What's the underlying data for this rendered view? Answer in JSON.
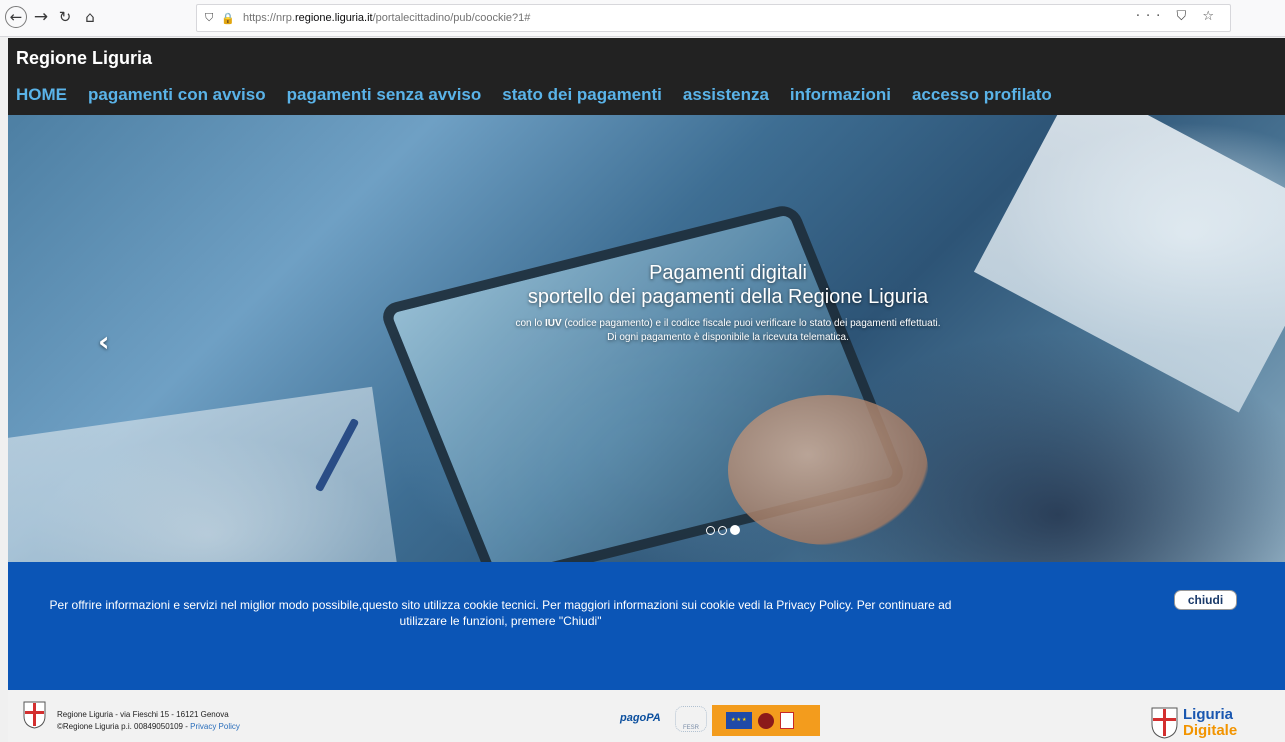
{
  "browser": {
    "url_prefix": "https://nrp.",
    "url_domain": "regione.liguria.it",
    "url_path": "/portalecittadino/pub/coockie?1#",
    "icons": [
      "back-arrow-icon",
      "forward-arrow-icon",
      "reload-icon",
      "home-icon",
      "shield-icon",
      "lock-icon",
      "more-icon",
      "pocket-icon",
      "bookmark-star-icon"
    ]
  },
  "site": {
    "brand": "Regione Liguria",
    "menu": [
      {
        "label": "HOME"
      },
      {
        "label": "pagamenti con avviso"
      },
      {
        "label": "pagamenti senza avviso"
      },
      {
        "label": "stato dei pagamenti"
      },
      {
        "label": "assistenza"
      },
      {
        "label": "informazioni"
      },
      {
        "label": "accesso profilato"
      }
    ],
    "colors": {
      "header_bg": "#222222",
      "menu_link": "#5ab3e8",
      "cookie_bg": "#0b55b6"
    }
  },
  "hero": {
    "title": "Pagamenti digitali",
    "subtitle": "sportello dei pagamenti della Regione Liguria",
    "text_pre": "con lo ",
    "text_bold": "IUV",
    "text_post": " (codice pagamento) e il codice fiscale puoi verificare lo stato dei pagamenti effettuati.",
    "text_line2": "Di ogni pagamento è disponibile la ricevuta telematica.",
    "slides": 3,
    "active_slide": 3
  },
  "cookie": {
    "message": "Per offrire informazioni e servizi nel miglior modo possibile,questo sito utilizza cookie tecnici. Per maggiori informazioni sui cookie vedi la Privacy Policy. Per continuare ad utilizzare le funzioni, premere \"Chiudi\"",
    "close_label": "chiudi"
  },
  "footer": {
    "address": "Regione Liguria - via Fieschi 15 - 16121 Genova",
    "copyright": "©Regione Liguria p.i. 00849050109 - ",
    "privacy_link": "Privacy Policy",
    "pagopa": "pagoPA",
    "fesr": "FESR",
    "ld_line1": "Liguria",
    "ld_line2": "Digitale"
  }
}
